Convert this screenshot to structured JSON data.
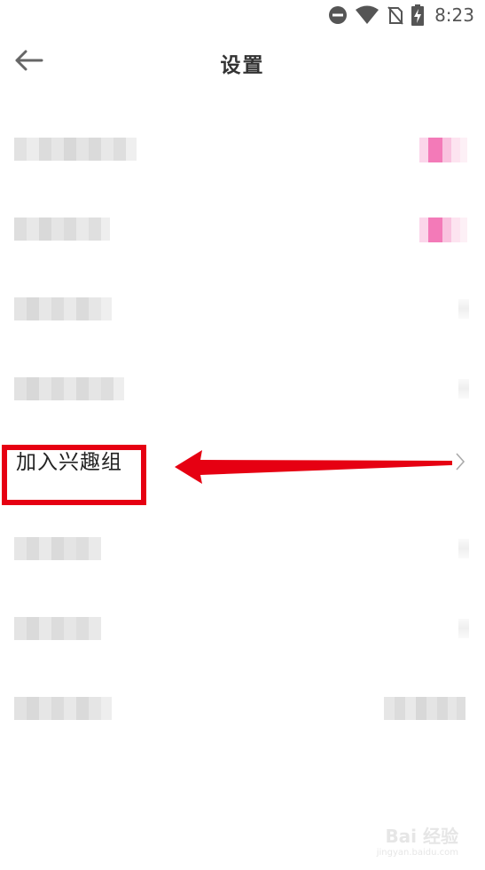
{
  "status_bar": {
    "time": "8:23",
    "icons": [
      "do-not-disturb-icon",
      "wifi-icon",
      "no-sim-icon",
      "battery-charging-icon"
    ]
  },
  "header": {
    "back_icon": "arrow-left-icon",
    "title": "设置"
  },
  "settings": {
    "highlighted_item": {
      "label": "加入兴趣组",
      "icon": "chevron-right-icon"
    }
  },
  "annotation": {
    "box_color": "#e60012",
    "arrow_color": "#e60012"
  },
  "watermark": {
    "main": "Bai 经验",
    "sub": "jingyan.baidu.com"
  },
  "colors": {
    "toggle_on": "#f060a8",
    "text": "#222222"
  }
}
